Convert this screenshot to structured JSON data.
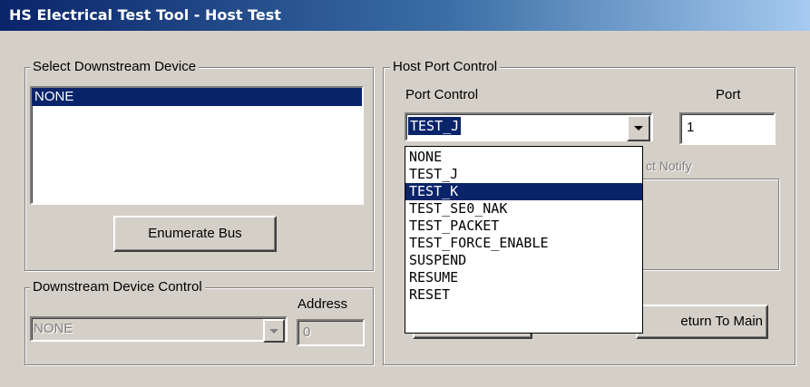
{
  "window": {
    "title": "HS Electrical Test Tool - Host Test"
  },
  "select_downstream": {
    "legend": "Select Downstream Device",
    "items": [
      "NONE"
    ],
    "selected_index": 0,
    "enumerate_label": "Enumerate Bus"
  },
  "downstream_control": {
    "legend": "Downstream Device Control",
    "address_label": "Address",
    "device_value": "NONE",
    "address_value": "0"
  },
  "host_port": {
    "legend": "Host Port Control",
    "port_control_label": "Port Control",
    "port_label": "Port",
    "port_control_value": "TEST_J",
    "port_value": "1",
    "hidden_label_fragment": "ct Notify",
    "return_label": "eturn To Main",
    "options": [
      "NONE",
      "TEST_J",
      "TEST_K",
      "TEST_SE0_NAK",
      "TEST_PACKET",
      "TEST_FORCE_ENABLE",
      "SUSPEND",
      "RESUME",
      "RESET"
    ],
    "highlighted_option": "TEST_K"
  },
  "colors": {
    "selection": "#0a246a",
    "face": "#d4d0c8",
    "title_gradient_end": "#a6caf0"
  }
}
